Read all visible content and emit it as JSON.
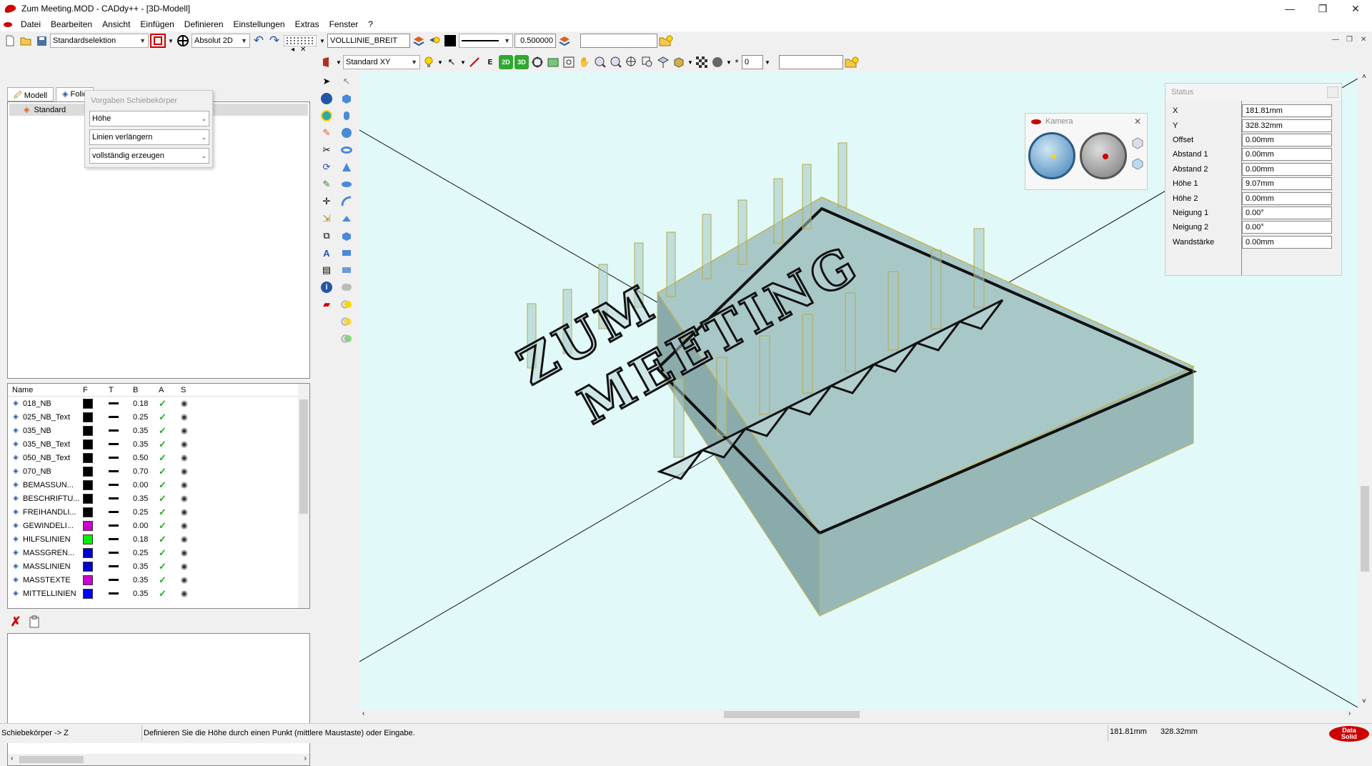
{
  "window": {
    "title": "Zum Meeting.MOD  -  CADdy++ - [3D-Modell]",
    "minimize": "—",
    "restore": "❐",
    "close": "✕"
  },
  "menu": {
    "items": [
      "Datei",
      "Bearbeiten",
      "Ansicht",
      "Einfügen",
      "Definieren",
      "Einstellungen",
      "Extras",
      "Fenster",
      "?"
    ]
  },
  "toolbar1": {
    "selection_mode": "Standardselektion",
    "coordinate_mode": "Absolut 2D",
    "line_type": "VOLLLINIE_BREIT",
    "line_width": "0.500000",
    "text_field": ""
  },
  "toolbar2": {
    "view_plane": "Standard XY",
    "label_2d": "2D",
    "label_3d": "3D",
    "counter_value": "0",
    "text_field": ""
  },
  "leftpanel": {
    "tabs": [
      "Modell",
      "Folie"
    ],
    "tree_item": "Standard",
    "layer_columns": [
      "Name",
      "F",
      "T",
      "B",
      "A",
      "S"
    ],
    "layers": [
      {
        "name": "018_NB",
        "color": "#000000",
        "width": "0.18"
      },
      {
        "name": "025_NB_Text",
        "color": "#000000",
        "width": "0.25"
      },
      {
        "name": "035_NB",
        "color": "#000000",
        "width": "0.35"
      },
      {
        "name": "035_NB_Text",
        "color": "#000000",
        "width": "0.35"
      },
      {
        "name": "050_NB_Text",
        "color": "#000000",
        "width": "0.50"
      },
      {
        "name": "070_NB",
        "color": "#000000",
        "width": "0.70"
      },
      {
        "name": "BEMASSUN...",
        "color": "#000000",
        "width": "0.00"
      },
      {
        "name": "BESCHRIFTU...",
        "color": "#000000",
        "width": "0.35"
      },
      {
        "name": "FREIHANDLI...",
        "color": "#000000",
        "width": "0.25"
      },
      {
        "name": "GEWINDELI...",
        "color": "#cc00cc",
        "width": "0.00"
      },
      {
        "name": "HILFSLINIEN",
        "color": "#00ee00",
        "width": "0.18"
      },
      {
        "name": "MASSGREN...",
        "color": "#0000cc",
        "width": "0.25"
      },
      {
        "name": "MASSLINIEN",
        "color": "#0000cc",
        "width": "0.35"
      },
      {
        "name": "MASSTEXTE",
        "color": "#cc00cc",
        "width": "0.35"
      },
      {
        "name": "MITTELLINIEN",
        "color": "#0000ff",
        "width": "0.35"
      }
    ]
  },
  "popup": {
    "title": "Vorgaben Schiebekörper",
    "options": [
      "Höhe",
      "Linien verlängern",
      "vollständig erzeugen"
    ]
  },
  "viewport": {
    "text_line1": "ZUM",
    "text_line2": "MEETING"
  },
  "camera": {
    "title": "Kamera"
  },
  "status_panel": {
    "title": "Status",
    "rows": [
      {
        "label": "X",
        "value": "181.81mm"
      },
      {
        "label": "Y",
        "value": "328.32mm"
      },
      {
        "label": "Offset",
        "value": "0.00mm"
      },
      {
        "label": "Abstand 1",
        "value": "0.00mm"
      },
      {
        "label": "Abstand 2",
        "value": "0.00mm"
      },
      {
        "label": "Höhe 1",
        "value": "9.07mm"
      },
      {
        "label": "Höhe 2",
        "value": "0.00mm"
      },
      {
        "label": "Neigung 1",
        "value": "0.00°"
      },
      {
        "label": "Neigung 2",
        "value": "0.00°"
      },
      {
        "label": "Wandstärke",
        "value": "0.00mm"
      }
    ]
  },
  "statusbar": {
    "mode": "Schiebekörper -> Z",
    "hint": "Definieren Sie die Höhe durch einen Punkt (mittlere Maustaste) oder Eingabe.",
    "x": "181.81mm",
    "y": "328.32mm",
    "logo_line1": "Data",
    "logo_line2": "Solid"
  },
  "colors": {
    "viewport_bg": "#e1faf9",
    "slab_fill": "#9fbfbf",
    "slab_edge": "#c8b040",
    "brand_red": "#cc0000"
  }
}
